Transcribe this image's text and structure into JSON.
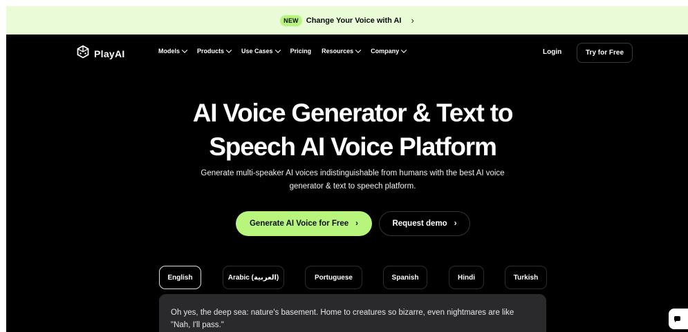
{
  "announcement": {
    "badge": "NEW",
    "text": "Change Your Voice with AI",
    "chevron": "›"
  },
  "nav": {
    "logo": "PlayAI",
    "items": [
      {
        "label": "Models",
        "dropdown": true
      },
      {
        "label": "Products",
        "dropdown": true
      },
      {
        "label": "Use Cases",
        "dropdown": true
      },
      {
        "label": "Pricing",
        "dropdown": false
      },
      {
        "label": "Resources",
        "dropdown": true
      },
      {
        "label": "Company",
        "dropdown": true
      }
    ],
    "login": "Login",
    "try": "Try for Free"
  },
  "hero": {
    "title_line1": "AI Voice Generator & Text to",
    "title_line2": "Speech AI Voice Platform",
    "subtitle": "Generate multi-speaker AI voices indistinguishable from humans with the best AI voice generator & text to speech platform.",
    "cta_primary": "Generate AI Voice for Free",
    "cta_secondary": "Request demo",
    "cta_chevron": "›"
  },
  "languages": [
    {
      "label": "English",
      "active": true
    },
    {
      "label": "Arabic (العربية)",
      "active": false
    },
    {
      "label": "Portuguese",
      "active": false
    },
    {
      "label": "Spanish",
      "active": false
    },
    {
      "label": "Hindi",
      "active": false
    },
    {
      "label": "Turkish",
      "active": false
    }
  ],
  "sample_text": "Oh yes, the deep sea: nature's basement. Home to creatures so bizarre, even nightmares are like \"Nah, I'll pass.\"",
  "colors": {
    "accent": "#b8f57d",
    "announcement_bg": "#eafbd8",
    "page_bg": "#000000"
  }
}
